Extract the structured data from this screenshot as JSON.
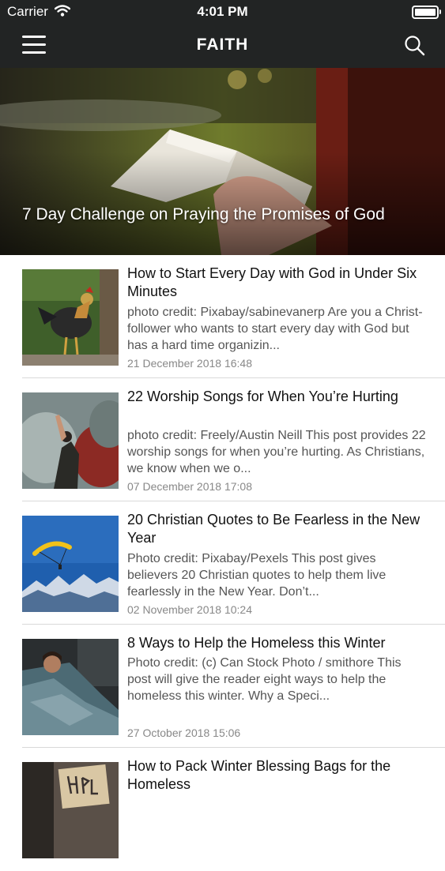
{
  "status_bar": {
    "carrier": "Carrier",
    "time": "4:01 PM"
  },
  "nav": {
    "title": "FAITH"
  },
  "hero": {
    "title": "7 Day Challenge on Praying the Promises of God"
  },
  "articles": [
    {
      "title": "How to Start Every Day with God in Under Six Minutes",
      "excerpt": "photo credit: Pixabay/sabinevanerp  Are you a Christ-follower who wants to start every day with God but has a hard time organizin...",
      "date": "21 December 2018 16:48"
    },
    {
      "title": "22 Worship Songs for When You’re Hurting",
      "excerpt": "photo credit: Freely/Austin Neill    This post provides 22 worship songs for when you’re hurting.  As Christians, we know when we o...",
      "date": "07 December 2018 17:08"
    },
    {
      "title": "20 Christian Quotes to Be Fearless in the New Year",
      "excerpt": "Photo credit: Pixabay/Pexels    This post gives believers 20 Christian quotes to help them live fearlessly in the New Year.  Don’t...",
      "date": "02 November 2018 10:24"
    },
    {
      "title": "8 Ways to Help the Homeless this Winter",
      "excerpt": "Photo credit: (c) Can Stock Photo / smithore This post will give the reader eight ways to help the homeless this winter.  Why a Speci...",
      "date": "27 October 2018 15:06"
    },
    {
      "title": "How to Pack Winter Blessing Bags for the Homeless",
      "excerpt": "",
      "date": ""
    }
  ]
}
